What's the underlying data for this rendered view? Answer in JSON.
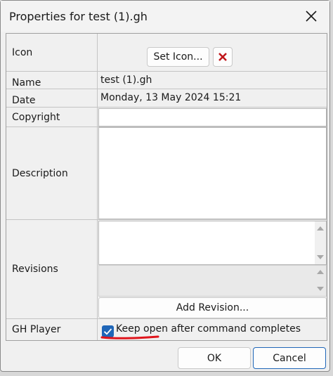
{
  "window": {
    "title": "Properties for test (1).gh"
  },
  "rows": {
    "icon_label": "Icon",
    "set_icon_button": "Set Icon...",
    "name_label": "Name",
    "name_value": "test (1).gh",
    "date_label": "Date",
    "date_value": "Monday, 13 May 2024 15:21",
    "copyright_label": "Copyright",
    "copyright_value": "",
    "description_label": "Description",
    "description_value": "",
    "revisions_label": "Revisions",
    "add_revision_button": "Add Revision...",
    "gh_player_label": "GH Player",
    "keep_open_label": "Keep open after command completes",
    "keep_open_checked": true
  },
  "footer": {
    "ok_button": "OK",
    "cancel_button": "Cancel"
  },
  "colors": {
    "accent": "#1f66b8",
    "delete_icon": "#c0171b",
    "annotation": "#e0151c"
  },
  "icons": {
    "close": "close-icon",
    "delete": "delete-icon",
    "check": "check-icon"
  }
}
